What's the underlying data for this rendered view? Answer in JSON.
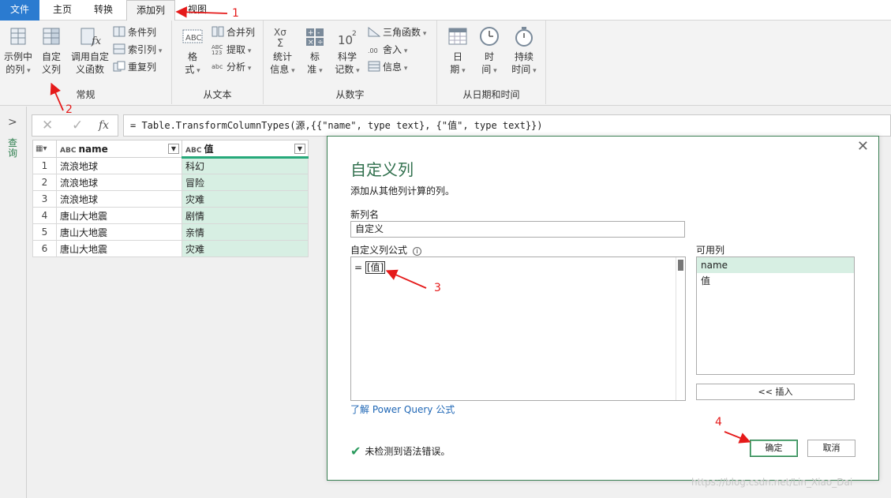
{
  "tabs": [
    {
      "label": "文件"
    },
    {
      "label": "主页"
    },
    {
      "label": "转换"
    },
    {
      "label": "添加列"
    },
    {
      "label": "视图"
    }
  ],
  "ribbon": {
    "general": {
      "label": "常规",
      "example_col": [
        "示例中",
        "的列"
      ],
      "custom_col": [
        "自定",
        "义列"
      ],
      "invoke_func": [
        "调用自定",
        "义函数"
      ],
      "conditional_col": "条件列",
      "index_col": "索引列",
      "duplicate_col": "重复列"
    },
    "from_text": {
      "label": "从文本",
      "format": [
        "格",
        "式"
      ],
      "merge_col": "合并列",
      "extract": "提取",
      "parse": "分析"
    },
    "from_number": {
      "label": "从数字",
      "statistics": [
        "统计",
        "信息"
      ],
      "standard": [
        "标",
        "准"
      ],
      "scientific": [
        "科学",
        "记数"
      ],
      "trig": "三角函数",
      "rounding": "舍入",
      "information": "信息"
    },
    "from_datetime": {
      "label": "从日期和时间",
      "date": [
        "日",
        "期"
      ],
      "time": [
        "时",
        "间"
      ],
      "duration": [
        "持续",
        "时间"
      ]
    }
  },
  "queries_pane": {
    "label": "查询"
  },
  "formula_bar": {
    "fx": "fx",
    "formula": "= Table.TransformColumnTypes(源,{{\"name\", type text}, {\"值\", type text}})"
  },
  "grid": {
    "columns": [
      "name",
      "值"
    ],
    "rows": [
      {
        "index": "1",
        "name": "流浪地球",
        "value": "科幻"
      },
      {
        "index": "2",
        "name": "流浪地球",
        "value": "冒险"
      },
      {
        "index": "3",
        "name": "流浪地球",
        "value": "灾难"
      },
      {
        "index": "4",
        "name": "唐山大地震",
        "value": "剧情"
      },
      {
        "index": "5",
        "name": "唐山大地震",
        "value": "亲情"
      },
      {
        "index": "6",
        "name": "唐山大地震",
        "value": "灾难"
      }
    ]
  },
  "dialog": {
    "title": "自定义列",
    "subtitle": "添加从其他列计算的列。",
    "new_col_label": "新列名",
    "new_col_value": "自定义",
    "formula_label": "自定义列公式",
    "formula_prefix": "= ",
    "formula_value": "[值]",
    "available_label": "可用列",
    "available_cols": [
      "name",
      "值"
    ],
    "insert_label": "<< 插入",
    "learn_link": "了解 Power Query 公式",
    "status": "未检测到语法错误。",
    "ok_label": "确定",
    "cancel_label": "取消"
  },
  "annotations": [
    "1",
    "2",
    "3",
    "4"
  ],
  "watermark": "https://blog.csdn.net/Lin_Xiao_Dai",
  "colors": {
    "accent": "#2b7bd0",
    "selection": "#d7efe3",
    "annotation": "#e51a1a",
    "dialog_title": "#2f6f4c"
  }
}
